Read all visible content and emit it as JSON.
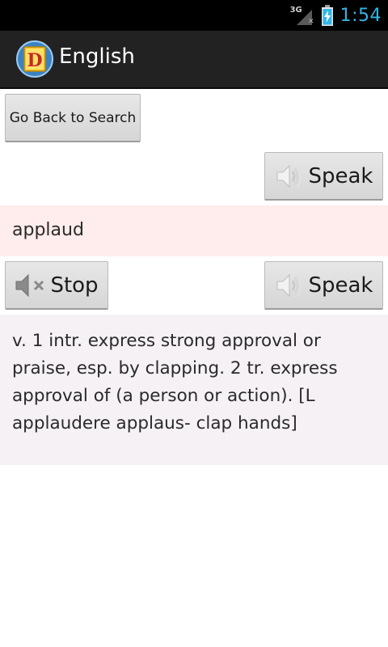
{
  "status_bar": {
    "network": "3G",
    "time": "1:54",
    "signal_icon": "signal-icon",
    "battery_icon": "battery-charging-icon"
  },
  "action_bar": {
    "title": "English",
    "app_icon": "dictionary-d-icon",
    "app_icon_letter": "D"
  },
  "buttons": {
    "back_label": "Go Back to Search",
    "speak_label": "Speak",
    "stop_label": "Stop"
  },
  "entry": {
    "word": "applaud",
    "definition": "v. 1 intr. express strong approval or praise, esp. by clapping. 2 tr. express approval of (a person or action). [L applaudere applaus- clap hands]"
  },
  "colors": {
    "status_bar": "#000000",
    "action_bar": "#222222",
    "clock": "#33b5e5",
    "word_band": "#ffecec",
    "definition_band": "#f5f1f5"
  }
}
